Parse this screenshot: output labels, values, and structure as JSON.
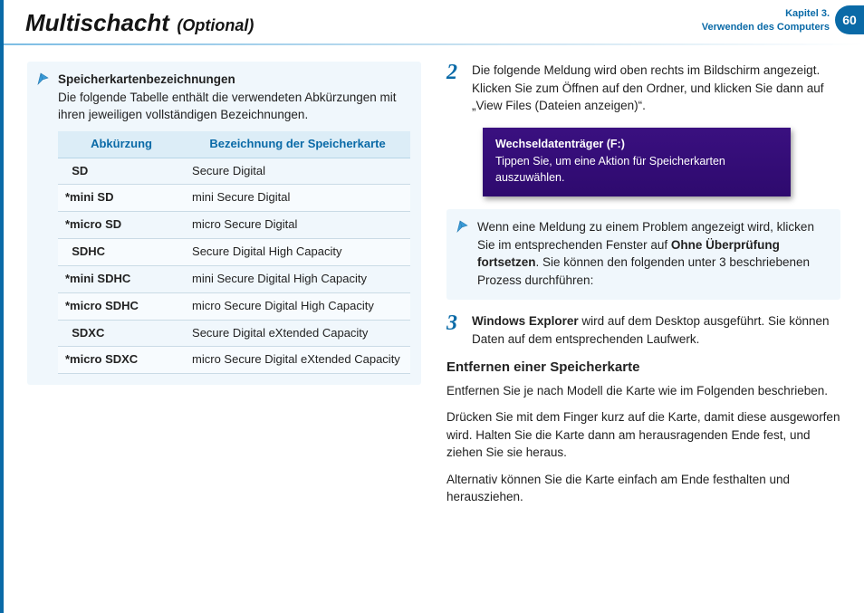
{
  "header": {
    "title": "Multischacht",
    "subtitle": "(Optional)",
    "chapter_line1": "Kapitel 3.",
    "chapter_line2": "Verwenden des Computers",
    "page_number": "60"
  },
  "left": {
    "note_title": "Speicherkartenbezeichnungen",
    "note_body": "Die folgende Tabelle enthält die verwendeten Abkürzungen mit ihren jeweiligen vollständigen Bezeichnungen.",
    "table": {
      "col1": "Abkürzung",
      "col2": "Bezeichnung der Speicherkarte",
      "rows": [
        {
          "abbr": "  SD",
          "full": "Secure Digital"
        },
        {
          "abbr": "*mini SD",
          "full": "mini Secure Digital"
        },
        {
          "abbr": "*micro SD",
          "full": "micro Secure Digital"
        },
        {
          "abbr": "  SDHC",
          "full": "Secure Digital High Capacity"
        },
        {
          "abbr": "*mini SDHC",
          "full": "mini Secure Digital High Capacity"
        },
        {
          "abbr": "*micro SDHC",
          "full": "micro Secure Digital High Capacity"
        },
        {
          "abbr": "  SDXC",
          "full": "Secure Digital eXtended Capacity"
        },
        {
          "abbr": "*micro SDXC",
          "full": "micro Secure Digital eXtended Capacity"
        }
      ]
    }
  },
  "right": {
    "step2_num": "2",
    "step2_text": "Die folgende Meldung wird oben rechts im Bildschirm angezeigt. Klicken Sie zum Öffnen auf den Ordner, und klicken Sie dann auf „View Files (Dateien anzeigen)“.",
    "msg_title": "Wechseldatenträger (F:)",
    "msg_body": "Tippen Sie, um eine Aktion für Speicherkarten auszuwählen.",
    "note2_pre": "Wenn eine Meldung zu einem Problem angezeigt wird, klicken Sie im entsprechenden Fenster auf ",
    "note2_bold": "Ohne Überprüfung fortsetzen",
    "note2_post": ". Sie können den folgenden unter 3 beschriebenen Prozess durchführen:",
    "step3_num": "3",
    "step3_bold": "Windows Explorer",
    "step3_text": " wird auf dem Desktop ausgeführt. Sie können Daten auf dem entsprechenden Laufwerk.",
    "section_heading": "Entfernen einer Speicherkarte",
    "para1": "Entfernen Sie je nach Modell die Karte wie im Folgenden beschrieben.",
    "para2": "Drücken Sie mit dem Finger kurz auf die Karte, damit diese ausgeworfen wird. Halten Sie die Karte dann am herausragenden Ende fest, und ziehen Sie sie heraus.",
    "para3": "Alternativ können Sie die Karte einfach am Ende festhalten und herausziehen."
  }
}
